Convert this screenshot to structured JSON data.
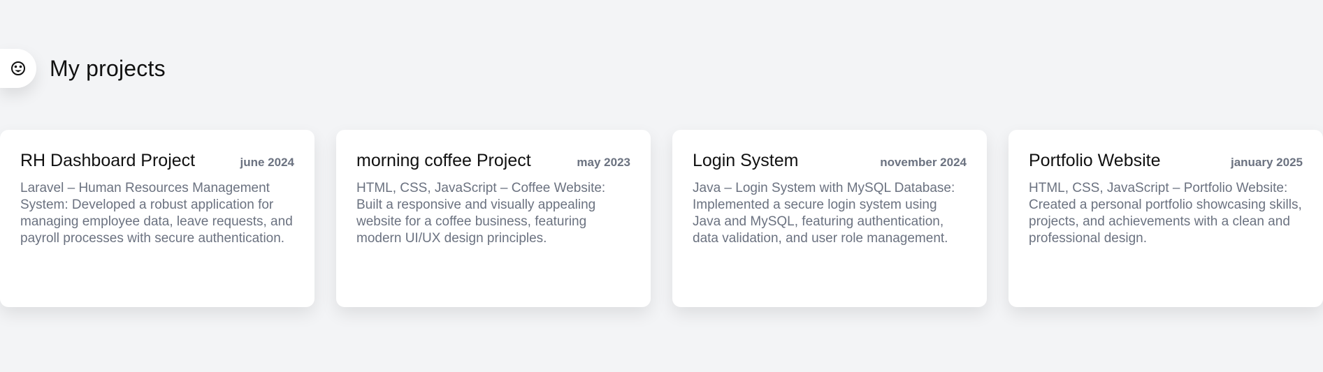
{
  "section": {
    "title": "My projects",
    "icon": "face-icon"
  },
  "projects": [
    {
      "title": "RH Dashboard Project",
      "date": "june 2024",
      "description": "Laravel – Human Resources Management System: Developed a robust application for managing employee data, leave requests, and payroll processes with secure authentication."
    },
    {
      "title": "morning coffee Project",
      "date": "may 2023",
      "description": "HTML, CSS, JavaScript – Coffee Website: Built a responsive and visually appealing website for a coffee business, featuring modern UI/UX design principles."
    },
    {
      "title": "Login System",
      "date": "november 2024",
      "description": "Java – Login System with MySQL Database: Implemented a secure login system using Java and MySQL, featuring authentication, data validation, and user role management."
    },
    {
      "title": "Portfolio Website",
      "date": "january 2025",
      "description": "HTML, CSS, JavaScript – Portfolio Website: Created a personal portfolio showcasing skills, projects, and achievements with a clean and professional design."
    }
  ]
}
